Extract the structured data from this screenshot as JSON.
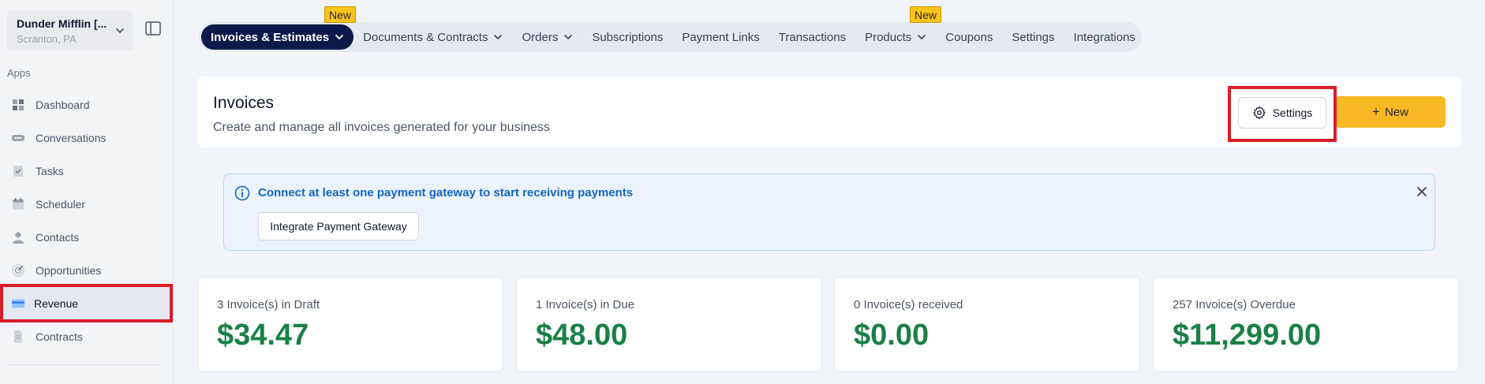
{
  "sidebar": {
    "account_name": "Dunder Mifflin [...",
    "account_location": "Scranton, PA",
    "section_label": "Apps",
    "items": [
      {
        "label": "Dashboard",
        "icon": "dashboard-icon"
      },
      {
        "label": "Conversations",
        "icon": "conversations-icon"
      },
      {
        "label": "Tasks",
        "icon": "tasks-icon"
      },
      {
        "label": "Scheduler",
        "icon": "calendar-icon"
      },
      {
        "label": "Contacts",
        "icon": "person-icon"
      },
      {
        "label": "Opportunities",
        "icon": "target-icon"
      },
      {
        "label": "Revenue",
        "icon": "credit-card-icon",
        "active": true
      },
      {
        "label": "Contracts",
        "icon": "document-icon"
      }
    ]
  },
  "topnav": {
    "tabs": [
      {
        "label": "Invoices & Estimates",
        "dropdown": true,
        "active": true
      },
      {
        "label": "Documents & Contracts",
        "dropdown": true
      },
      {
        "label": "Orders",
        "dropdown": true
      },
      {
        "label": "Subscriptions"
      },
      {
        "label": "Payment Links"
      },
      {
        "label": "Transactions"
      },
      {
        "label": "Products",
        "dropdown": true
      },
      {
        "label": "Coupons"
      },
      {
        "label": "Settings"
      },
      {
        "label": "Integrations"
      }
    ],
    "new_badge": "New"
  },
  "header": {
    "title": "Invoices",
    "subtitle": "Create and manage all invoices generated for your business",
    "settings_label": "Settings",
    "new_label": "New",
    "new_icon": "+"
  },
  "alert": {
    "message": "Connect at least one payment gateway to start receiving payments",
    "button_label": "Integrate Payment Gateway"
  },
  "stats": [
    {
      "label": "3 Invoice(s) in Draft",
      "value": "$34.47"
    },
    {
      "label": "1 Invoice(s) in Due",
      "value": "$48.00"
    },
    {
      "label": "0 Invoice(s) received",
      "value": "$0.00"
    },
    {
      "label": "257 Invoice(s) Overdue",
      "value": "$11,299.00"
    }
  ],
  "colors": {
    "accent": "#0b1a4a",
    "primary_button": "#f9b826",
    "value_green": "#1a8046",
    "highlight": "#d81e2a",
    "alert_text": "#1565c0"
  }
}
